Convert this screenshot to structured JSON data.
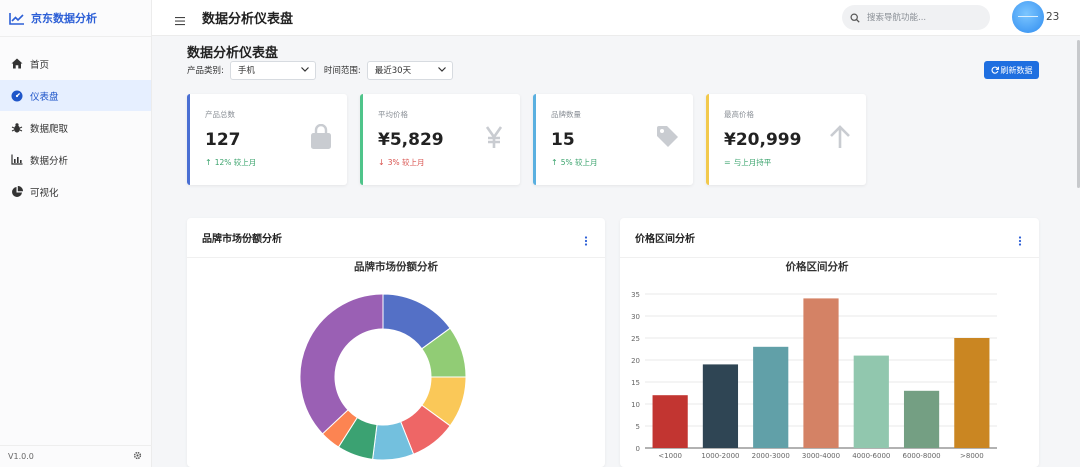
{
  "sidebar": {
    "brand": "京东数据分析",
    "items": [
      {
        "label": "首页",
        "icon": "home-icon",
        "active": false
      },
      {
        "label": "仪表盘",
        "icon": "dashboard-icon",
        "active": true
      },
      {
        "label": "数据爬取",
        "icon": "bug-icon",
        "active": false
      },
      {
        "label": "数据分析",
        "icon": "chart-line-icon",
        "active": false
      },
      {
        "label": "可视化",
        "icon": "pie-chart-icon",
        "active": false
      }
    ],
    "version": "V1.0.0"
  },
  "topbar": {
    "title": "数据分析仪表盘",
    "search_placeholder": "搜索导航功能...",
    "user_suffix": "23"
  },
  "main": {
    "title": "数据分析仪表盘",
    "filters": {
      "category_label": "产品类别:",
      "category_value": "手机",
      "range_label": "时间范围:",
      "range_value": "最近30天"
    },
    "refresh_label": "刷新数据"
  },
  "stats": [
    {
      "label": "产品总数",
      "value": "127",
      "trend": "12% 较上月",
      "direction": "up",
      "color": "#4a6fd3",
      "icon": "bag-icon"
    },
    {
      "label": "平均价格",
      "value": "¥5,829",
      "trend": "3% 较上月",
      "direction": "down",
      "color": "#4fc48a",
      "icon": "yen-icon"
    },
    {
      "label": "品牌数量",
      "value": "15",
      "trend": "5% 较上月",
      "direction": "up",
      "color": "#5ab0e0",
      "icon": "tag-icon"
    },
    {
      "label": "最高价格",
      "value": "¥20,999",
      "trend": "与上月持平",
      "direction": "flat",
      "color": "#f2c94c",
      "icon": "arrow-up-icon"
    }
  ],
  "panels": {
    "brand_share_title": "品牌市场份额分析",
    "price_range_title": "价格区间分析"
  },
  "chart_data": [
    {
      "type": "pie",
      "title": "品牌市场份额分析",
      "values": [
        15,
        10,
        10,
        9,
        8,
        7,
        4,
        37
      ],
      "colors": [
        "#5470c6",
        "#91cc75",
        "#fac858",
        "#ee6666",
        "#73c0de",
        "#3ba272",
        "#fc8452",
        "#9a60b4"
      ]
    },
    {
      "type": "bar",
      "title": "价格区间分析",
      "categories": [
        "<1000",
        "1000-2000",
        "2000-3000",
        "3000-4000",
        "4000-6000",
        "6000-8000",
        ">8000"
      ],
      "values": [
        12,
        19,
        23,
        34,
        21,
        13,
        25
      ],
      "colors": [
        "#c23531",
        "#2f4554",
        "#61a0a8",
        "#d48265",
        "#91c7ae",
        "#749f83",
        "#ca8622"
      ],
      "ylim": [
        0,
        35
      ],
      "yticks": [
        0,
        5,
        10,
        15,
        20,
        25,
        30,
        35
      ],
      "grid": true
    }
  ]
}
